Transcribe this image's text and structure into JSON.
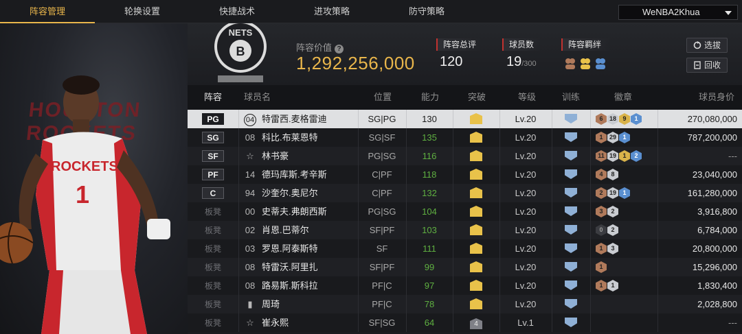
{
  "tabs": [
    "阵容管理",
    "轮换设置",
    "快捷战术",
    "进攻策略",
    "防守策略"
  ],
  "team_select": {
    "value": "WeNBA2Khua"
  },
  "header": {
    "value_label": "阵容价值",
    "value": "1,292,256,000",
    "stats": [
      {
        "label": "阵容总评",
        "value": "120",
        "suffix": ""
      },
      {
        "label": "球员数",
        "value": "19",
        "suffix": "/300"
      },
      {
        "label": "阵容羁绊",
        "value": "",
        "suffix": ""
      }
    ],
    "buttons": {
      "select": "选拔",
      "recall": "回收"
    },
    "logo_text": "NETS"
  },
  "player_art": {
    "bg_text": "HOUSTON ROCKETS",
    "jersey_text": "ROCKETS"
  },
  "table": {
    "columns": [
      "阵容",
      "球员名",
      "位置",
      "能力",
      "突破",
      "等级",
      "训练",
      "徽章",
      "球员身价"
    ],
    "rows": [
      {
        "slot": "PG",
        "bench": false,
        "num": "04",
        "name": "特雷西.麦格雷迪",
        "pos": "SG|PG",
        "rating": "130",
        "break": "crown",
        "level": "Lv.20",
        "badges": [
          [
            "bronze",
            "6"
          ],
          [
            "silver",
            "18"
          ],
          [
            "gold",
            "9"
          ],
          [
            "blue",
            "1"
          ]
        ],
        "price": "270,080,000"
      },
      {
        "slot": "SG",
        "bench": false,
        "num": "08",
        "name": "科比.布莱恩特",
        "pos": "SG|SF",
        "rating": "135",
        "break": "crown",
        "level": "Lv.20",
        "badges": [
          [
            "bronze",
            "1"
          ],
          [
            "silver",
            "29"
          ],
          [
            "blue",
            "1"
          ]
        ],
        "price": "787,200,000"
      },
      {
        "slot": "SF",
        "bench": false,
        "num": "☆",
        "name": "林书豪",
        "pos": "PG|SG",
        "rating": "116",
        "break": "crown",
        "level": "Lv.20",
        "badges": [
          [
            "bronze",
            "11"
          ],
          [
            "silver",
            "19"
          ],
          [
            "gold",
            "1"
          ],
          [
            "blue",
            "2"
          ]
        ],
        "price": "---"
      },
      {
        "slot": "PF",
        "bench": false,
        "num": "14",
        "name": "德玛库斯.考辛斯",
        "pos": "C|PF",
        "rating": "118",
        "break": "crown",
        "level": "Lv.20",
        "badges": [
          [
            "bronze",
            "4"
          ],
          [
            "silver",
            "8"
          ]
        ],
        "price": "23,040,000"
      },
      {
        "slot": "C",
        "bench": false,
        "num": "94",
        "name": "沙奎尔.奥尼尔",
        "pos": "C|PF",
        "rating": "132",
        "break": "crown",
        "level": "Lv.20",
        "badges": [
          [
            "bronze",
            "2"
          ],
          [
            "silver",
            "19"
          ],
          [
            "blue",
            "1"
          ]
        ],
        "price": "161,280,000"
      },
      {
        "slot": "板凳",
        "bench": true,
        "num": "00",
        "name": "史蒂夫.弗朗西斯",
        "pos": "PG|SG",
        "rating": "104",
        "break": "crown",
        "level": "Lv.20",
        "badges": [
          [
            "bronze",
            "3"
          ],
          [
            "silver",
            "2"
          ]
        ],
        "price": "3,916,800"
      },
      {
        "slot": "板凳",
        "bench": true,
        "num": "02",
        "name": "肖恩.巴蒂尔",
        "pos": "SF|PF",
        "rating": "103",
        "break": "crown",
        "level": "Lv.20",
        "badges": [
          [
            "dark",
            "0"
          ],
          [
            "silver",
            "2"
          ]
        ],
        "price": "6,784,000"
      },
      {
        "slot": "板凳",
        "bench": true,
        "num": "03",
        "name": "罗恩.阿泰斯特",
        "pos": "SF",
        "rating": "111",
        "break": "crown",
        "level": "Lv.20",
        "badges": [
          [
            "bronze",
            "1"
          ],
          [
            "silver",
            "3"
          ]
        ],
        "price": "20,800,000"
      },
      {
        "slot": "板凳",
        "bench": true,
        "num": "08",
        "name": "特雷沃.阿里扎",
        "pos": "SF|PF",
        "rating": "99",
        "break": "crown",
        "level": "Lv.20",
        "badges": [
          [
            "bronze",
            "1"
          ]
        ],
        "price": "15,296,000"
      },
      {
        "slot": "板凳",
        "bench": true,
        "num": "08",
        "name": "路易斯.斯科拉",
        "pos": "PF|C",
        "rating": "97",
        "break": "crown",
        "level": "Lv.20",
        "badges": [
          [
            "bronze",
            "1"
          ],
          [
            "silver",
            "1"
          ]
        ],
        "price": "1,830,400"
      },
      {
        "slot": "板凳",
        "bench": true,
        "num": "▮",
        "name": "周琦",
        "pos": "PF|C",
        "rating": "78",
        "break": "crown",
        "level": "Lv.20",
        "badges": [],
        "price": "2,028,800"
      },
      {
        "slot": "板凳",
        "bench": true,
        "num": "☆",
        "name": "崔永熙",
        "pos": "SF|SG",
        "rating": "64",
        "break": "4",
        "level": "Lv.1",
        "badges": [],
        "price": "---"
      }
    ]
  },
  "colors": {
    "accent": "#e9b64b",
    "rating_green": "#5fb041",
    "stat_marker": "#c2322f"
  }
}
